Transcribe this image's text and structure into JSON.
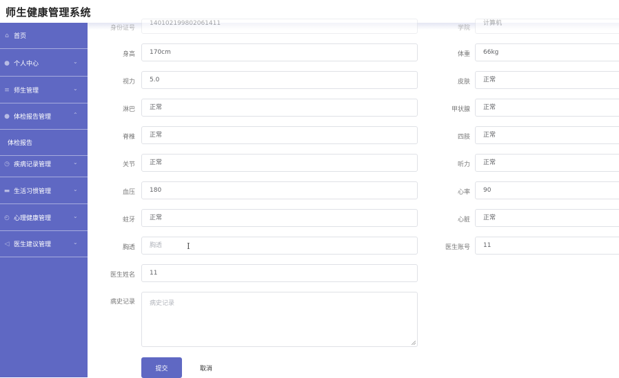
{
  "app_title": "师生健康管理系统",
  "sidebar": {
    "items": [
      {
        "label": "首页",
        "icon": "home-icon",
        "glyph": "⌂",
        "chevron": ""
      },
      {
        "label": "个人中心",
        "icon": "user-icon",
        "glyph": "●",
        "chevron": "⌄"
      },
      {
        "label": "师生管理",
        "icon": "list-icon",
        "glyph": "≡",
        "chevron": "⌄"
      },
      {
        "label": "体检报告管理",
        "icon": "user-icon",
        "glyph": "●",
        "chevron": "⌃"
      },
      {
        "label": "体检报告",
        "icon": "",
        "glyph": "",
        "chevron": ""
      },
      {
        "label": "疾病记录管理",
        "icon": "clock-icon",
        "glyph": "◷",
        "chevron": "⌄"
      },
      {
        "label": "生活习惯管理",
        "icon": "monitor-icon",
        "glyph": "▬",
        "chevron": "⌄"
      },
      {
        "label": "心理健康管理",
        "icon": "compass-icon",
        "glyph": "◴",
        "chevron": "⌄"
      },
      {
        "label": "医生建议管理",
        "icon": "send-icon",
        "glyph": "◁",
        "chevron": "⌄"
      }
    ]
  },
  "form": {
    "top_cut": {
      "left_label": "身份证号",
      "left_value": "140102199802061411",
      "right_label": "学院",
      "right_value": "计算机"
    },
    "rows": [
      {
        "left_label": "身高",
        "left_value": "170cm",
        "right_label": "体重",
        "right_value": "66kg"
      },
      {
        "left_label": "视力",
        "left_value": "5.0",
        "right_label": "皮肤",
        "right_value": "正常"
      },
      {
        "left_label": "淋巴",
        "left_value": "正常",
        "right_label": "甲状腺",
        "right_value": "正常"
      },
      {
        "left_label": "脊椎",
        "left_value": "正常",
        "right_label": "四肢",
        "right_value": "正常"
      },
      {
        "left_label": "关节",
        "left_value": "正常",
        "right_label": "听力",
        "right_value": "正常"
      },
      {
        "left_label": "血压",
        "left_value": "180",
        "right_label": "心率",
        "right_value": "90"
      },
      {
        "left_label": "蛀牙",
        "left_value": "正常",
        "right_label": "心脏",
        "right_value": "正常"
      }
    ],
    "chest": {
      "label": "胸透",
      "placeholder": "胸透"
    },
    "doctor_account": {
      "label": "医生账号",
      "value": "11"
    },
    "doctor_name": {
      "label": "医生姓名",
      "value": "11"
    },
    "history": {
      "label": "病史记录",
      "placeholder": "病史记录"
    },
    "submit_label": "提交",
    "cancel_label": "取消"
  },
  "colors": {
    "sidebar": "#5f68c3",
    "accent": "#5f68c3"
  }
}
